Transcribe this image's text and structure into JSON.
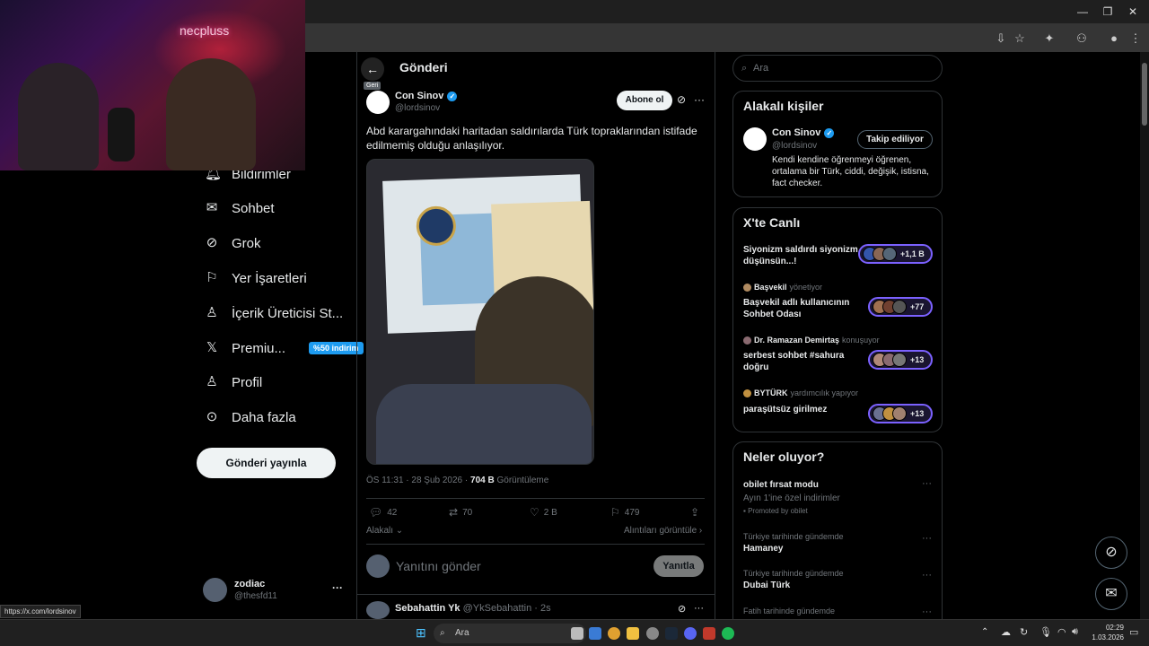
{
  "webcam": {
    "brand": "necpluss"
  },
  "nav": {
    "items": [
      {
        "label": "Bildirimler",
        "icon": "bell-icon"
      },
      {
        "label": "Sohbet",
        "icon": "mail-icon"
      },
      {
        "label": "Grok",
        "icon": "grok-icon"
      },
      {
        "label": "Yer İşaretleri",
        "icon": "bookmark-icon"
      },
      {
        "label": "İçerik Üreticisi St...",
        "icon": "creator-studio-icon"
      },
      {
        "label": "Premiu...",
        "icon": "x-logo-icon",
        "badge": "%50 indirim"
      },
      {
        "label": "Profil",
        "icon": "profile-icon"
      },
      {
        "label": "Daha fazla",
        "icon": "more-circle-icon"
      }
    ],
    "post_button": "Gönderi yayınla",
    "user": {
      "name": "zodiac",
      "handle": "@thesfd11",
      "more": "···"
    }
  },
  "post": {
    "header": "Gönderi",
    "back_tooltip": "Geri",
    "author": {
      "name": "Con Sinov",
      "handle": "@lordsinov"
    },
    "subscribe": "Abone ol",
    "text": "Abd karargahındaki haritadan saldırılarda Türk topraklarından istifade edilmemiş olduğu anlaşılıyor.",
    "time": "ÖS 11:31 · 28 Şub 2026 · ",
    "views": "704 B",
    "views_label": " Görüntüleme",
    "stats": {
      "replies": "42",
      "reposts": "70",
      "likes": "2 B",
      "bookmarks": "479"
    },
    "relevant": "Alakalı",
    "quotes": "Alıntıları görüntüle ›",
    "reply_placeholder": "Yanıtını gönder",
    "reply_button": "Yanıtla",
    "next_reply": {
      "name": "Sebahattin Yk",
      "handle": "@YkSebahattin · 2s"
    }
  },
  "sidebar": {
    "search_placeholder": "Ara",
    "relevant_title": "Alakalı kişiler",
    "person": {
      "name": "Con Sinov",
      "handle": "@lordsinov",
      "button": "Takip ediliyor",
      "bio": "Kendi kendine öğrenmeyi öğrenen, ortalama bir Türk, ciddi, değişik, istisna, fact checker."
    },
    "live_title": "X'te Canlı",
    "live": [
      {
        "host": "",
        "role": "",
        "title": "Siyonizm saldırdı siyonizm düşünsün...!",
        "count": "+1,1 B"
      },
      {
        "host": "Başvekil",
        "role": "yönetiyor",
        "title": "Başvekil adlı kullanıcının Sohbet Odası",
        "count": "+77"
      },
      {
        "host": "Dr. Ramazan Demirtaş",
        "role": "konuşuyor",
        "title": "serbest sohbet #sahura doğru",
        "count": "+13"
      },
      {
        "host": "BYTÜRK",
        "role": "yardımcılık yapıyor",
        "title": "paraşütsüz girilmez",
        "count": "+13"
      }
    ],
    "trends_title": "Neler oluyor?",
    "trends": [
      {
        "label": "",
        "name": "obilet fırsat modu",
        "desc": "Ayın 1'ine özel indirimler",
        "promo": "Promoted by obilet"
      },
      {
        "label": "Türkiye tarihinde gündemde",
        "name": "Hamaney"
      },
      {
        "label": "Türkiye tarihinde gündemde",
        "name": "Dubai Türk"
      },
      {
        "label": "Fatih tarihinde gündemde",
        "name": ""
      }
    ]
  },
  "status_url": "https://x.com/lordsinov",
  "taskbar": {
    "search": "Ara",
    "time": "02:29",
    "date": "1.03.2026"
  }
}
